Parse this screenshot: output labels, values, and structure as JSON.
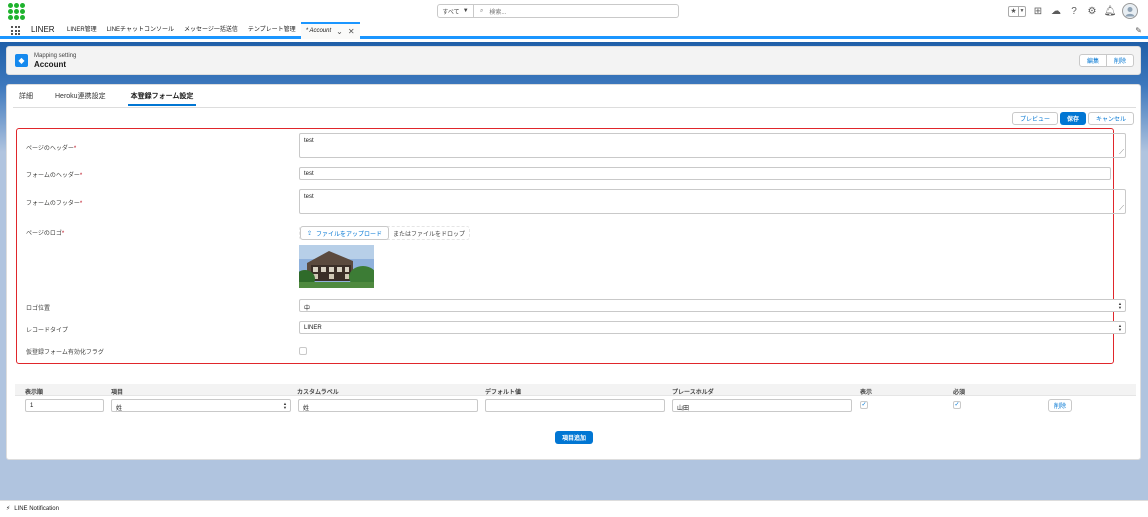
{
  "global_header": {
    "search_scope": "すべて",
    "search_placeholder": "検索..."
  },
  "nav": {
    "app_name": "LINER",
    "items": [
      {
        "label": "LINER管理"
      },
      {
        "label": "LINEチャットコンソール"
      },
      {
        "label": "メッセージ一括送信"
      },
      {
        "label": "テンプレート管理"
      }
    ],
    "active_tab": "* Account"
  },
  "record": {
    "object_label": "Mapping setting",
    "title": "Account",
    "edit_button": "編集",
    "delete_button": "削除"
  },
  "tabs": [
    {
      "label": "詳細",
      "active": false
    },
    {
      "label": "Heroku連携設定",
      "active": false
    },
    {
      "label": "本登録フォーム設定",
      "active": true
    }
  ],
  "form_actions": {
    "preview": "プレビュー",
    "save": "保存",
    "cancel": "キャンセル"
  },
  "form": {
    "page_header": {
      "label": "ページのヘッダー",
      "required": "*",
      "value": "test"
    },
    "form_header": {
      "label": "フォームのヘッダー",
      "required": "*",
      "value": "test"
    },
    "form_footer": {
      "label": "フォームのフッター",
      "required": "*",
      "value": "test"
    },
    "page_logo": {
      "label": "ページのロゴ",
      "required": "*",
      "upload_button": "ファイルをアップロード",
      "drop_text": "またはファイルをドロップ"
    },
    "logo_position": {
      "label": "ロゴ位置",
      "value": "中"
    },
    "record_type": {
      "label": "レコードタイプ",
      "value": "LINER"
    },
    "temp_flag": {
      "label": "仮登録フォーム有効化フラグ",
      "checked": false
    }
  },
  "items_table": {
    "headers": [
      "表示順",
      "項目",
      "カスタムラベル",
      "デフォルト値",
      "プレースホルダ",
      "表示",
      "必須"
    ],
    "rows": [
      {
        "order": "1",
        "field": "姓",
        "custom_label": "姓",
        "default_value": "",
        "placeholder": "山田",
        "visible": true,
        "required": true,
        "delete_label": "削除"
      }
    ],
    "add_button": "項目追加"
  },
  "utility_bar": {
    "item": "LINE Notification"
  },
  "colors": {
    "brand_blue": "#0176d3",
    "highlight_border": "#e0262b",
    "logo_green": "#1fb32e"
  }
}
